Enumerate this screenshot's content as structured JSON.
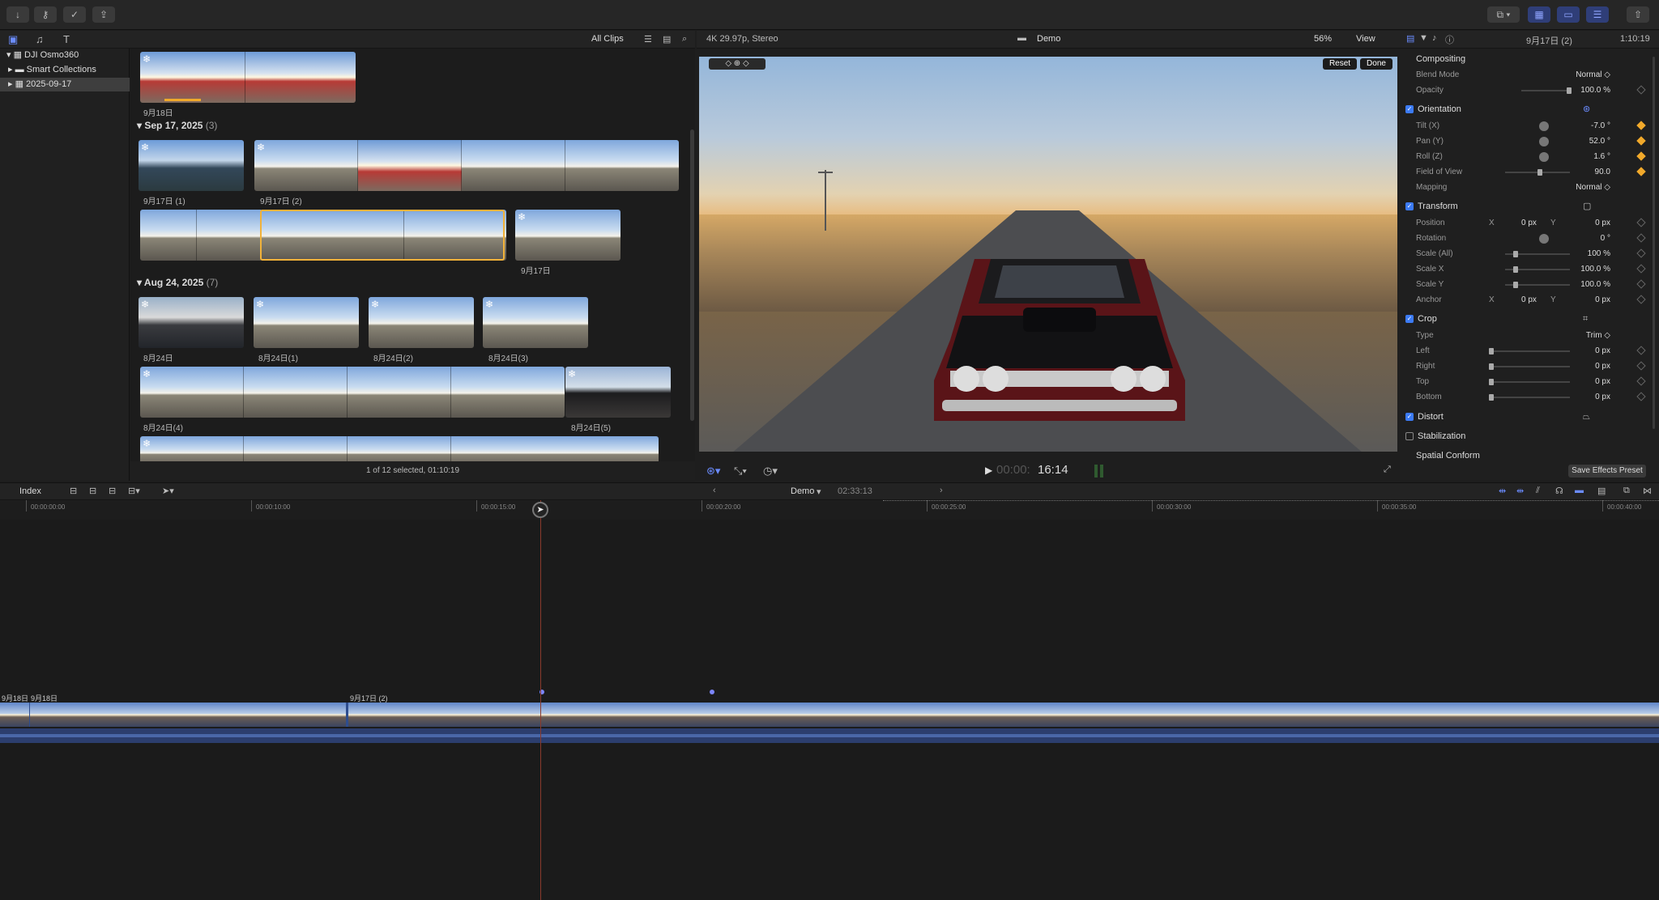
{
  "library": {
    "items": [
      {
        "label": "DJI Osmo360"
      },
      {
        "label": "Smart Collections"
      },
      {
        "label": "2025-09-17"
      }
    ]
  },
  "browser": {
    "filter_label": "All Clips",
    "footer": "1 of 12 selected, 01:10:19",
    "top_clip_label": "9月18日",
    "groups": [
      {
        "date": "Sep 17, 2025",
        "count": "(3)"
      },
      {
        "date": "Aug 24, 2025",
        "count": "(7)"
      }
    ],
    "clip_labels": [
      "9月17日 (1)",
      "9月17日 (2)",
      "9月17日",
      "8月24日",
      "8月24日(1)",
      "8月24日(2)",
      "8月24日(3)",
      "8月24日(4)",
      "8月24日(5)"
    ]
  },
  "viewer": {
    "format": "4K 29.97p, Stereo",
    "project_name": "Demo",
    "zoom": "56%",
    "view_label": "View",
    "reset_label": "Reset",
    "done_label": "Done",
    "timecode_dim": "00:00:",
    "timecode": "16:14"
  },
  "inspector": {
    "clip_name": "9月17日 (2)",
    "duration": "1:10:19",
    "compositing": "Compositing",
    "blend_mode_label": "Blend Mode",
    "blend_mode": "Normal ◇",
    "opacity_label": "Opacity",
    "opacity": "100.0 %",
    "orientation": "Orientation",
    "tilt_label": "Tilt (X)",
    "tilt": "-7.0 °",
    "pan_label": "Pan (Y)",
    "pan": "52.0 °",
    "roll_label": "Roll (Z)",
    "roll": "1.6 °",
    "fov_label": "Field of View",
    "fov": "90.0",
    "mapping_label": "Mapping",
    "mapping": "Normal ◇",
    "transform": "Transform",
    "position_label": "Position",
    "position_x": "0 px",
    "position_y": "0 px",
    "x_label": "X",
    "y_label": "Y",
    "rotation_label": "Rotation",
    "rotation": "0 °",
    "scale_all_label": "Scale (All)",
    "scale_all": "100 %",
    "scale_x_label": "Scale X",
    "scale_x": "100.0 %",
    "scale_y_label": "Scale Y",
    "scale_y": "100.0 %",
    "anchor_label": "Anchor",
    "anchor_x": "0 px",
    "anchor_y": "0 px",
    "crop": "Crop",
    "type_label": "Type",
    "type": "Trim ◇",
    "left_label": "Left",
    "left": "0 px",
    "right_label": "Right",
    "right": "0 px",
    "top_label": "Top",
    "top": "0 px",
    "bottom_label": "Bottom",
    "bottom": "0 px",
    "distort": "Distort",
    "stabilization": "Stabilization",
    "spatial_conform": "Spatial Conform",
    "save_preset": "Save Effects Preset"
  },
  "timeline": {
    "index_label": "Index",
    "project_name": "Demo",
    "duration": "02:33:13",
    "ruler": [
      "00:00:00:00",
      "00:00:10:00",
      "00:00:15:00",
      "00:00:20:00",
      "00:00:25:00",
      "00:00:30:00",
      "00:00:35:00",
      "00:00:40:00"
    ],
    "clip_labels": [
      "9月18日",
      "9月18日",
      "9月17日 (2)"
    ]
  },
  "colors": {
    "accent": "#3c7bf5",
    "selection": "#f1b23a",
    "keyframe": "#f1a92b",
    "storyline": "#2e4d8e"
  }
}
